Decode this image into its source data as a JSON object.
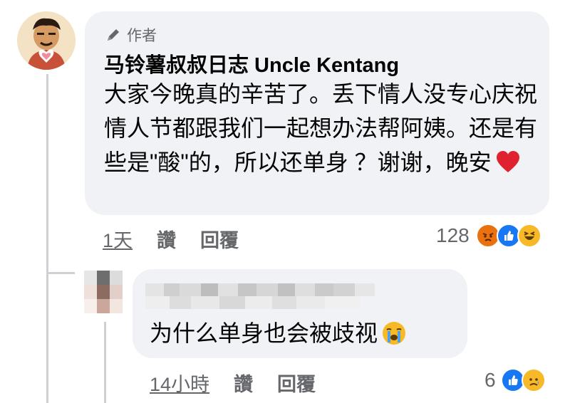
{
  "top_comment": {
    "badge_label": "作者",
    "author": "马铃薯叔叔日志 Uncle Kentang",
    "text": "大家今晚真的辛苦了。丢下情人没专心庆祝情人节都跟我们一起想办法帮阿姨。还是有些是\"酸\"的，所以还单身 ？谢谢，晚安",
    "time": "1天",
    "like_label": "讚",
    "reply_label": "回覆",
    "reaction_count": "128",
    "reactions": [
      "angry-icon",
      "like-icon",
      "haha-icon"
    ]
  },
  "reply_comment": {
    "text": "为什么单身也会被歧视",
    "time": "14小時",
    "like_label": "讚",
    "reply_label": "回覆",
    "reaction_count": "6",
    "reactions": [
      "like-icon",
      "sad-icon"
    ]
  },
  "colors": {
    "bubble": "#f0f2f5",
    "meta_text": "#65676b",
    "like_blue": "#1877f2",
    "heart_red": "#e0212f",
    "angry": "#e9710f",
    "haha_yellow": "#f7b928"
  }
}
